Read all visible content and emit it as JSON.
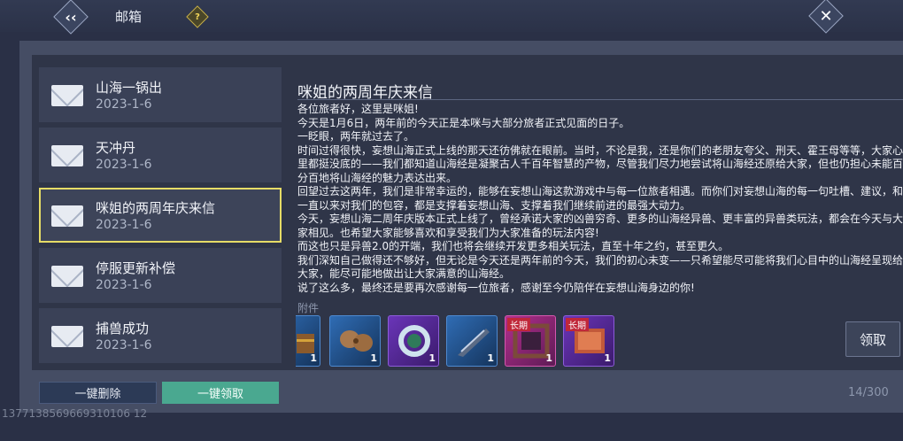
{
  "header": {
    "title": "邮箱",
    "help_glyph": "?",
    "back_glyph": "‹‹",
    "close_glyph": "✕"
  },
  "mails": [
    {
      "subject": "山海一锅出",
      "date": "2023-1-6",
      "selected": false
    },
    {
      "subject": "天冲丹",
      "date": "2023-1-6",
      "selected": false
    },
    {
      "subject": "咪姐的两周年庆来信",
      "date": "2023-1-6",
      "selected": true
    },
    {
      "subject": "停服更新补偿",
      "date": "2023-1-6",
      "selected": false
    },
    {
      "subject": "捕兽成功",
      "date": "2023-1-6",
      "selected": false
    }
  ],
  "detail": {
    "title": "咪姐的两周年庆来信",
    "paragraphs": [
      "各位旅者好，这里是咪姐!",
      "今天是1月6日，两年前的今天正是本咪与大部分旅者正式见面的日子。",
      "一眨眼，两年就过去了。",
      "时间过得很快，妄想山海正式上线的那天还彷佛就在眼前。当时，不论是我，还是你们的老朋友夸父、刑天、霍王母等等，大家心里都挺没底的——我们都知道山海经是凝聚古人千百年智慧的产物，尽管我们尽力地尝试将山海经还原给大家，但也仍担心未能百分百地将山海经的魅力表达出来。",
      "回望过去这两年，我们是非常幸运的，能够在妄想山海这款游戏中与每一位旅者相遇。而你们对妄想山海的每一句吐槽、建议，和一直以来对我们的包容，都是支撑着妄想山海、支撑着我们继续前进的最强大动力。",
      "今天，妄想山海二周年庆版本正式上线了，曾经承诺大家的凶兽穷奇、更多的山海经异兽、更丰富的异兽类玩法，都会在今天与大家相见。也希望大家能够喜欢和享受我们为大家准备的玩法内容!",
      "而这也只是异兽2.0的开端，我们也将会继续开发更多相关玩法，直至十年之约，甚至更久。",
      "我们深知自己做得还不够好，但无论是今天还是两年前的今天，我们的初心未变——只希望能尽可能将我们心目中的山海经呈现给大家，能尽可能地做出让大家满意的山海经。",
      "说了这么多，最终还是要再次感谢每一位旅者，感谢至今仍陪伴在妄想山海身边的你!"
    ],
    "attachments_label": "附件",
    "attachments": [
      {
        "icon": "chest-icon",
        "qty": "1",
        "rarity_color": "#2f6cb4",
        "tag": ""
      },
      {
        "icon": "seed-icon",
        "qty": "1",
        "rarity_color": "#2f6cb4",
        "tag": ""
      },
      {
        "icon": "gem-ring-icon",
        "qty": "1",
        "rarity_color": "#6a35b8",
        "tag": ""
      },
      {
        "icon": "feather-icon",
        "qty": "1",
        "rarity_color": "#2f6cb4",
        "tag": ""
      },
      {
        "icon": "frame-icon",
        "qty": "1",
        "rarity_color": "#b12f8d",
        "tag": "长期"
      },
      {
        "icon": "card-icon",
        "qty": "1",
        "rarity_color": "#6a35b8",
        "tag": "长期"
      }
    ],
    "claim_label": "领取"
  },
  "footer": {
    "delete_all_label": "一键删除",
    "claim_all_label": "一键领取",
    "mail_count": "14/300",
    "uid": "1377138569669310106 12"
  }
}
